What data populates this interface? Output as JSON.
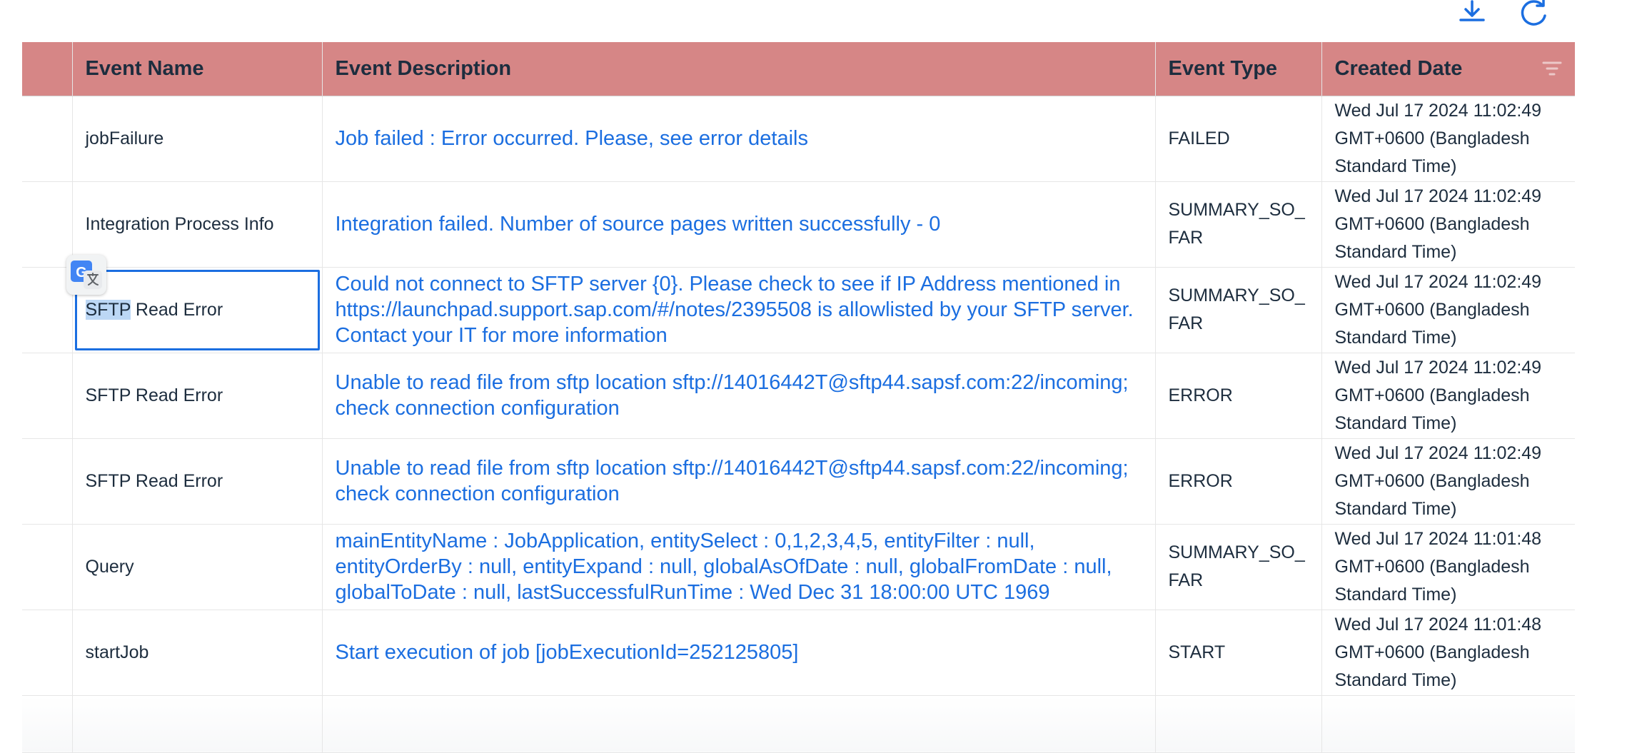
{
  "toolbar": {
    "download_icon": "download-icon",
    "refresh_icon": "refresh-icon",
    "icon_color": "#1b6ee0"
  },
  "table": {
    "header_color": "#d68686",
    "link_color": "#1b6ee0",
    "columns": [
      "Event Name",
      "Event Description",
      "Event Type",
      "Created Date"
    ],
    "rows": [
      {
        "name_parts": [
          "",
          "jobFailure"
        ],
        "description": "Job failed : Error occurred. Please, see error details",
        "type": "FAILED",
        "created": [
          "Wed Jul 17 2024 11:02:49",
          "GMT+0600 (Bangladesh",
          "Standard Time)"
        ]
      },
      {
        "name_parts": [
          "",
          "Integration Process Info"
        ],
        "description": "Integration failed. Number of source pages written successfully - 0",
        "type": "SUMMARY_SO_ FAR",
        "created": [
          "Wed Jul 17 2024 11:02:49",
          "GMT+0600 (Bangladesh",
          "Standard Time)"
        ]
      },
      {
        "name_parts": [
          "SFTP",
          " Read Error"
        ],
        "description": "Could not connect to SFTP server {0}. Please check to see if IP Address mentioned in https://launchpad.support.sap.com/#/notes/2395508 is allowlisted by your SFTP server. Contact your IT for more information",
        "type": "SUMMARY_SO_ FAR",
        "created": [
          "Wed Jul 17 2024 11:02:49",
          "GMT+0600 (Bangladesh",
          "Standard Time)"
        ]
      },
      {
        "name_parts": [
          "",
          "SFTP Read Error"
        ],
        "description": "Unable to read file from sftp location sftp://14016442T@sftp44.sapsf.com:22/incoming; check connection configuration",
        "type": "ERROR",
        "created": [
          "Wed Jul 17 2024 11:02:49",
          "GMT+0600 (Bangladesh",
          "Standard Time)"
        ]
      },
      {
        "name_parts": [
          "",
          "SFTP Read Error"
        ],
        "description": "Unable to read file from sftp location sftp://14016442T@sftp44.sapsf.com:22/incoming; check connection configuration",
        "type": "ERROR",
        "created": [
          "Wed Jul 17 2024 11:02:49",
          "GMT+0600 (Bangladesh",
          "Standard Time)"
        ]
      },
      {
        "name_parts": [
          "",
          "Query"
        ],
        "description": "mainEntityName : JobApplication, entitySelect : 0,1,2,3,4,5, entityFilter : null, entityOrderBy : null, entityExpand : null, globalAsOfDate : null, globalFromDate : null, globalToDate : null, lastSuccessfulRunTime : Wed Dec 31 18:00:00 UTC 1969",
        "type": "SUMMARY_SO_ FAR",
        "created": [
          "Wed Jul 17 2024 11:01:48",
          "GMT+0600 (Bangladesh",
          "Standard Time)"
        ]
      },
      {
        "name_parts": [
          "",
          "startJob"
        ],
        "description": "Start execution of job [jobExecutionId=252125805]",
        "type": "START",
        "created": [
          "Wed Jul 17 2024 11:01:48",
          "GMT+0600 (Bangladesh",
          "Standard Time)"
        ]
      }
    ]
  },
  "translate_badge": {
    "letter": "G",
    "icon": "google-translate-icon"
  }
}
